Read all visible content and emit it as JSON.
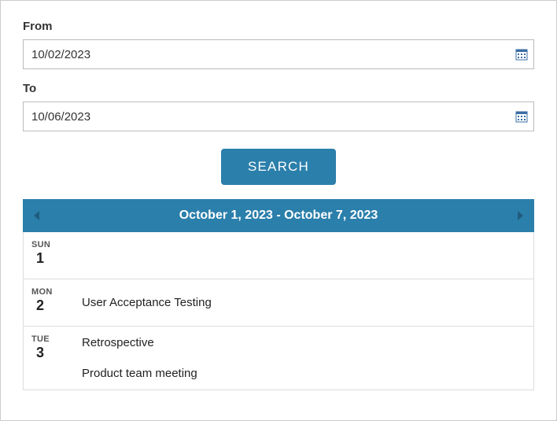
{
  "form": {
    "from_label": "From",
    "from_value": "10/02/2023",
    "to_label": "To",
    "to_value": "10/06/2023",
    "search_label": "SEARCH"
  },
  "calendar": {
    "range_title": "October 1, 2023 - October 7, 2023",
    "days": [
      {
        "abbr": "SUN",
        "num": "1",
        "events": []
      },
      {
        "abbr": "MON",
        "num": "2",
        "events": [
          "User Acceptance Testing"
        ]
      },
      {
        "abbr": "TUE",
        "num": "3",
        "events": [
          "Retrospective",
          "Product team meeting"
        ]
      }
    ]
  }
}
